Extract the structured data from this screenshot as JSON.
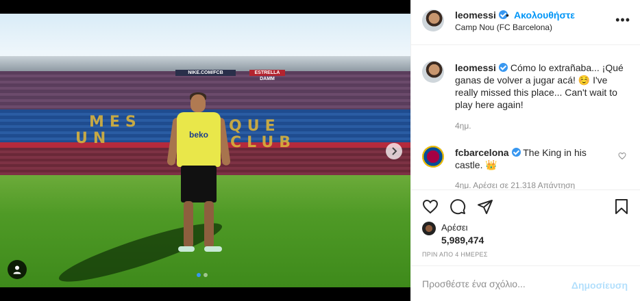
{
  "post": {
    "username": "leomessi",
    "separator": "•",
    "follow_label": "Ακολουθήστε",
    "location": "Camp Nou (FC Barcelona)",
    "more_label": "•••"
  },
  "photo": {
    "banner_nike": "NIKE.COM/FCB",
    "banner_estrella": "ESTRELLA DAMM",
    "seats_line1": "MES",
    "seats_line2": "UN",
    "seats_line3": "QUE",
    "seats_line4": "CLUB",
    "shirt_logo": "beko"
  },
  "caption": {
    "username": "leomessi",
    "text": "Cómo lo extrañaba... ¡Qué ganas de volver a jugar acá! ☺️ I've really missed this place... Can't wait to play here again!",
    "time": "4ημ."
  },
  "reply": {
    "username": "fcbarcelona",
    "text": "The King in his castle. 👑",
    "meta": "4ημ.    Αρέσει σε 21.318    Απάντηση"
  },
  "likes": {
    "label": "Αρέσει",
    "count": "5,989,474"
  },
  "post_date": "ΠΡΙΝ ΑΠΟ 4 ΗΜΕΡΕΣ",
  "comment_box": {
    "placeholder": "Προσθέστε ένα σχόλιο...",
    "publish_label": "Δημοσίευση"
  },
  "colors": {
    "link_blue": "#0095f6",
    "publish_disabled": "#b2dffc",
    "verified_blue": "#3897f0",
    "muted": "#8e8e8e"
  },
  "carousel": {
    "total": 2,
    "active_index": 0
  }
}
